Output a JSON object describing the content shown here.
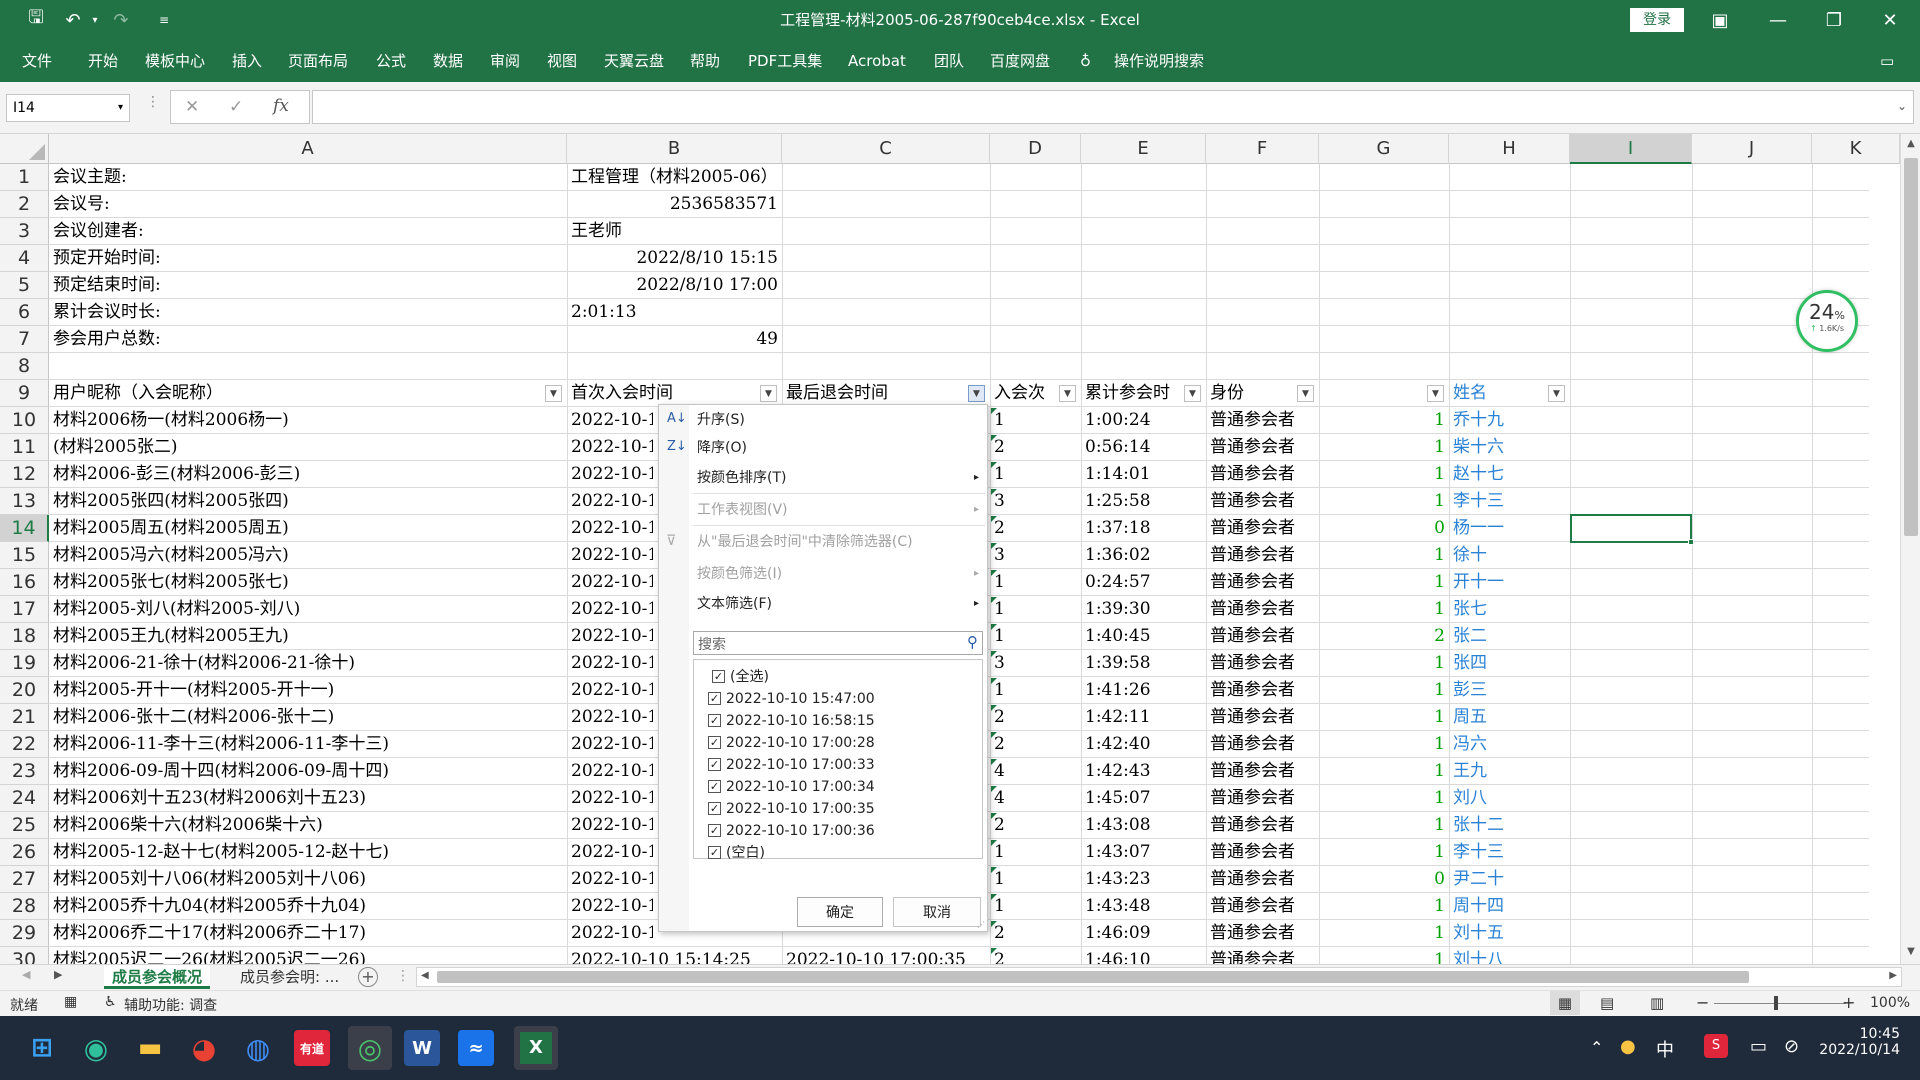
{
  "window": {
    "title": "工程管理-材料2005-06-287f90ceb4ce.xlsx  -  Excel",
    "login": "登录"
  },
  "menu": [
    "文件",
    "开始",
    "模板中心",
    "插入",
    "页面布局",
    "公式",
    "数据",
    "审阅",
    "视图",
    "天翼云盘",
    "帮助",
    "PDF工具集",
    "Acrobat",
    "团队",
    "百度网盘"
  ],
  "search_hint": "操作说明搜索",
  "namebox": "I14",
  "col_letters": [
    "A",
    "B",
    "C",
    "D",
    "E",
    "F",
    "G",
    "H",
    "I",
    "J",
    "K"
  ],
  "info_rows": [
    {
      "label": "会议主题:",
      "value": "工程管理（材料2005-06）"
    },
    {
      "label": "会议号:",
      "value": "2536583571"
    },
    {
      "label": "会议创建者:",
      "value": "王老师"
    },
    {
      "label": "预定开始时间:",
      "value": "2022/8/10  15:15"
    },
    {
      "label": "预定结束时间:",
      "value": "2022/8/10  17:00"
    },
    {
      "label": "累计会议时长:",
      "value": "2:01:13"
    },
    {
      "label": "参会用户总数:",
      "value": "49"
    }
  ],
  "headers": [
    "用户昵称（入会昵称）",
    "首次入会时间",
    "最后退会时间",
    "入会次",
    "累计参会时",
    "身份",
    "",
    "姓名"
  ],
  "rows": [
    {
      "nick": "材料2006杨一(材料2006杨一)",
      "first": "2022-10-1",
      "count": "1",
      "dur": "1:00:24",
      "role": "普通参会者",
      "g": "1",
      "name": "乔十九"
    },
    {
      "nick": "(材料2005张二)",
      "first": "2022-10-1",
      "count": "2",
      "dur": "0:56:14",
      "role": "普通参会者",
      "g": "1",
      "name": "柴十六"
    },
    {
      "nick": "材料2006-彭三(材料2006-彭三)",
      "first": "2022-10-1",
      "count": "1",
      "dur": "1:14:01",
      "role": "普通参会者",
      "g": "1",
      "name": "赵十七"
    },
    {
      "nick": "材料2005张四(材料2005张四)",
      "first": "2022-10-1",
      "count": "3",
      "dur": "1:25:58",
      "role": "普通参会者",
      "g": "1",
      "name": "李十三"
    },
    {
      "nick": "材料2005周五(材料2005周五)",
      "first": "2022-10-1",
      "count": "2",
      "dur": "1:37:18",
      "role": "普通参会者",
      "g": "0",
      "name": "杨一一"
    },
    {
      "nick": "材料2005冯六(材料2005冯六)",
      "first": "2022-10-1",
      "count": "3",
      "dur": "1:36:02",
      "role": "普通参会者",
      "g": "1",
      "name": "徐十"
    },
    {
      "nick": "材料2005张七(材料2005张七)",
      "first": "2022-10-1",
      "count": "1",
      "dur": "0:24:57",
      "role": "普通参会者",
      "g": "1",
      "name": "开十一"
    },
    {
      "nick": "材料2005-刘八(材料2005-刘八)",
      "first": "2022-10-1",
      "count": "1",
      "dur": "1:39:30",
      "role": "普通参会者",
      "g": "1",
      "name": "张七"
    },
    {
      "nick": "材料2005王九(材料2005王九)",
      "first": "2022-10-1",
      "count": "1",
      "dur": "1:40:45",
      "role": "普通参会者",
      "g": "2",
      "name": "张二"
    },
    {
      "nick": "材料2006-21-徐十(材料2006-21-徐十)",
      "first": "2022-10-1",
      "count": "3",
      "dur": "1:39:58",
      "role": "普通参会者",
      "g": "1",
      "name": "张四"
    },
    {
      "nick": "材料2005-开十一(材料2005-开十一)",
      "first": "2022-10-1",
      "count": "1",
      "dur": "1:41:26",
      "role": "普通参会者",
      "g": "1",
      "name": "彭三"
    },
    {
      "nick": "材料2006-张十二(材料2006-张十二)",
      "first": "2022-10-1",
      "count": "2",
      "dur": "1:42:11",
      "role": "普通参会者",
      "g": "1",
      "name": "周五"
    },
    {
      "nick": "材料2006-11-李十三(材料2006-11-李十三)",
      "first": "2022-10-1",
      "count": "2",
      "dur": "1:42:40",
      "role": "普通参会者",
      "g": "1",
      "name": "冯六"
    },
    {
      "nick": "材料2006-09-周十四(材料2006-09-周十四)",
      "first": "2022-10-1",
      "count": "4",
      "dur": "1:42:43",
      "role": "普通参会者",
      "g": "1",
      "name": "王九"
    },
    {
      "nick": "材料2006刘十五23(材料2006刘十五23)",
      "first": "2022-10-1",
      "count": "4",
      "dur": "1:45:07",
      "role": "普通参会者",
      "g": "1",
      "name": "刘八"
    },
    {
      "nick": "材料2006柴十六(材料2006柴十六)",
      "first": "2022-10-1",
      "count": "2",
      "dur": "1:43:08",
      "role": "普通参会者",
      "g": "1",
      "name": "张十二"
    },
    {
      "nick": "材料2005-12-赵十七(材料2005-12-赵十七)",
      "first": "2022-10-1",
      "count": "1",
      "dur": "1:43:07",
      "role": "普通参会者",
      "g": "1",
      "name": "李十三"
    },
    {
      "nick": "材料2005刘十八06(材料2005刘十八06)",
      "first": "2022-10-1",
      "count": "1",
      "dur": "1:43:23",
      "role": "普通参会者",
      "g": "0",
      "name": "尹二十"
    },
    {
      "nick": "材料2005乔十九04(材料2005乔十九04)",
      "first": "2022-10-1",
      "count": "1",
      "dur": "1:43:48",
      "role": "普通参会者",
      "g": "1",
      "name": "周十四"
    },
    {
      "nick": "材料2006乔二十17(材料2006乔二十17)",
      "first": "2022-10-1",
      "count": "2",
      "dur": "1:46:09",
      "role": "普通参会者",
      "g": "1",
      "name": "刘十五"
    },
    {
      "nick": "材料2005迟二一26(材料2005迟二一26)",
      "first": "2022-10-10  15:14:25",
      "last": "2022-10-10  17:00:35",
      "count": "2",
      "dur": "1:46:10",
      "role": "普通参会者",
      "g": "1",
      "name": "刘十八"
    }
  ],
  "dropdown": {
    "sort_asc": "升序(S)",
    "sort_desc": "降序(O)",
    "sort_color": "按颜色排序(T)",
    "sheet_view": "工作表视图(V)",
    "clear_filter": "从\"最后退会时间\"中清除筛选器(C)",
    "filter_color": "按颜色筛选(I)",
    "text_filter": "文本筛选(F)",
    "search_placeholder": "搜索",
    "items": [
      "(全选)",
      "2022-10-10 15:47:00",
      "2022-10-10 16:58:15",
      "2022-10-10 17:00:28",
      "2022-10-10 17:00:33",
      "2022-10-10 17:00:34",
      "2022-10-10 17:00:35",
      "2022-10-10 17:00:36",
      "(空白)"
    ],
    "ok": "确定",
    "cancel": "取消"
  },
  "sheets": [
    "成员参会概况",
    "成员参会明: ..."
  ],
  "status": {
    "ready": "就绪",
    "access": "辅助功能: 调查",
    "zoom": "100%"
  },
  "net": {
    "percent": "24",
    "unit": "%",
    "speed": "1.6K/s"
  },
  "clock": {
    "time": "10:45",
    "date": "2022/10/14"
  },
  "ime": "中"
}
